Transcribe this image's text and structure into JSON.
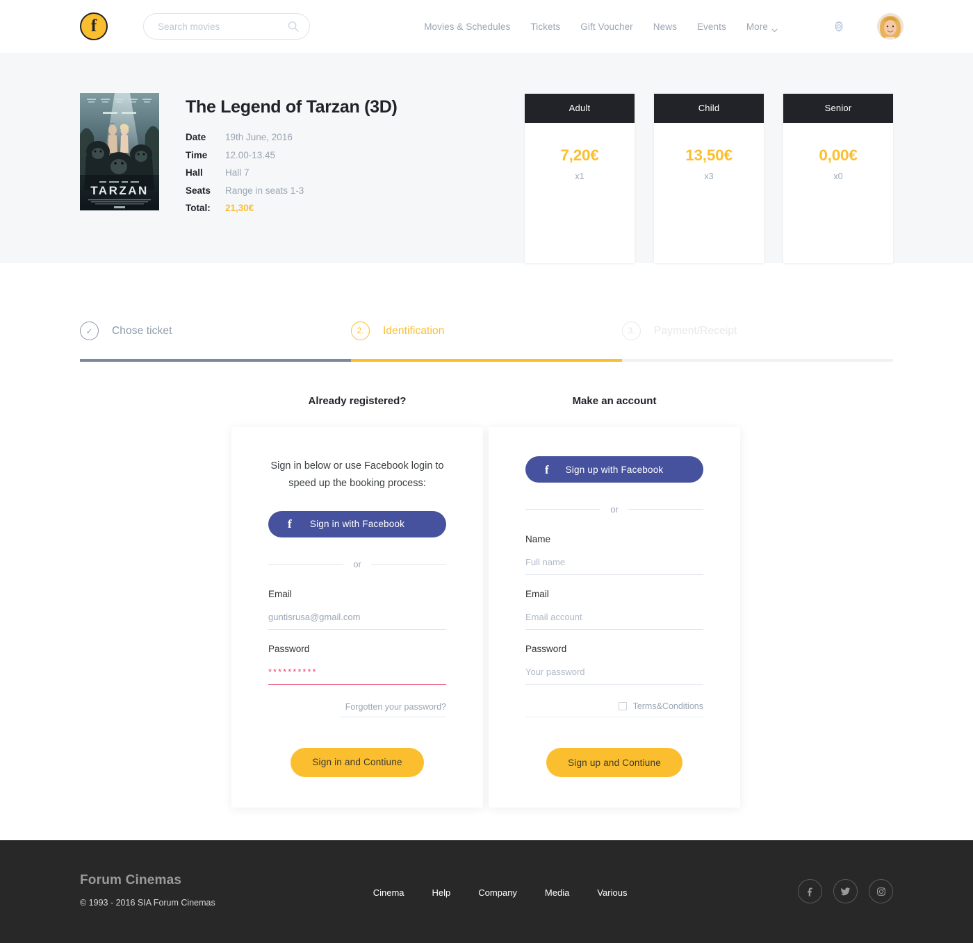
{
  "header": {
    "logo_letter": "f",
    "search": {
      "placeholder": "Search movies",
      "value": "",
      "icon": "search-icon"
    },
    "nav": [
      {
        "label": "Movies & Schedules",
        "has_chevron": false
      },
      {
        "label": "Tickets",
        "has_chevron": false
      },
      {
        "label": "Gift Voucher",
        "has_chevron": false
      },
      {
        "label": "News",
        "has_chevron": false
      },
      {
        "label": "Events",
        "has_chevron": false
      },
      {
        "label": "More",
        "has_chevron": true
      }
    ],
    "settings_icon": "gear-icon",
    "avatar_icon": "user-avatar"
  },
  "summary": {
    "poster_alt": "The Legend of Tarzan poster",
    "movie_title": "The Legend of Tarzan (3D)",
    "details": [
      {
        "label": "Date",
        "value": "19th June, 2016"
      },
      {
        "label": "Time",
        "value": "12.00-13.45"
      },
      {
        "label": "Hall",
        "value": "Hall 7"
      },
      {
        "label": "Seats",
        "value": "Range in seats 1-3"
      }
    ],
    "total_label": "Total:",
    "total_value": "21,30€",
    "price_cards": [
      {
        "type": "Adult",
        "price": "7,20€",
        "count": "x1"
      },
      {
        "type": "Child",
        "price": "13,50€",
        "count": "x3"
      },
      {
        "type": "Senior",
        "price": "0,00€",
        "count": "x0"
      }
    ]
  },
  "stepper": {
    "steps": [
      {
        "marker": "✓",
        "label": "Chose ticket",
        "state": "done"
      },
      {
        "marker": "2.",
        "label": "Identification",
        "state": "active"
      },
      {
        "marker": "3.",
        "label": "Payment/Receipt",
        "state": "upcoming"
      }
    ]
  },
  "signin": {
    "heading": "Already registered?",
    "intro": "Sign in below or use Facebook login to speed up the booking process:",
    "facebook_button": "Sign in with Facebook",
    "facebook_glyph": "f",
    "or": "or",
    "email_label": "Email",
    "email_value": "guntisrusa@gmail.com",
    "password_label": "Password",
    "password_value": "••••••••••",
    "password_masked": "**********",
    "forgot_link": "Forgotten your password?",
    "submit": "Sign in and Contiune"
  },
  "signup": {
    "heading": "Make an account",
    "facebook_button": "Sign up with Facebook",
    "facebook_glyph": "f",
    "or": "or",
    "name_label": "Name",
    "name_placeholder": "Full name",
    "email_label": "Email",
    "email_placeholder": "Email account",
    "password_label": "Password",
    "password_placeholder": "Your password",
    "terms_label": "Terms&Conditions",
    "terms_checked": false,
    "submit": "Sign up and Contiune"
  },
  "footer": {
    "title": "Forum Cinemas",
    "copyright": "© 1993 - 2016 SIA Forum Cinemas",
    "links": [
      "Cinema",
      "Help",
      "Company",
      "Media",
      "Various"
    ],
    "social": [
      "facebook-icon",
      "twitter-icon",
      "instagram-icon"
    ]
  },
  "colors": {
    "accent_yellow": "#FBBE2E",
    "facebook_blue": "#46529D",
    "dark": "#212328",
    "footer_bg": "#282828",
    "muted_text": "#9AA6B4",
    "error_red": "#E84A6F",
    "summary_bg": "#F6F7F8"
  }
}
